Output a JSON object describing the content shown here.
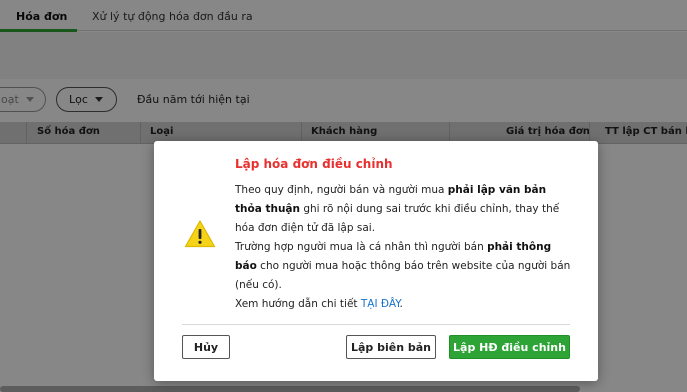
{
  "tabs": [
    {
      "label": "Hóa đơn",
      "active": true
    },
    {
      "label": "Xử lý tự động hóa đơn đầu ra",
      "active": false
    }
  ],
  "filters": {
    "truncated_chip": "oạt",
    "filter_chip": "Lọc",
    "period": "Đầu năm tới hiện tại"
  },
  "table": {
    "columns": [
      "Số hóa đơn",
      "Loại",
      "Khách hàng",
      "Giá trị hóa đơn",
      "TT lập CT bán hàng"
    ]
  },
  "dialog": {
    "title": "Lập hóa đơn điều chỉnh",
    "p1_a": "Theo quy định, người bán và người mua ",
    "p1_b": "phải lập văn bản thỏa thuận",
    "p1_c": " ghi rõ nội dung sai trước khi điều chỉnh, thay thế hóa đơn điện tử đã lập sai.",
    "p2_a": "Trường hợp người mua là cá nhân thì người bán ",
    "p2_b": "phải thông báo",
    "p2_c": " cho người mua hoặc thông báo trên website của người bán (nếu có).",
    "p3_a": "Xem hướng dẫn chi tiết ",
    "p3_link": "TẠI ĐÂY",
    "p3_c": ".",
    "buttons": {
      "cancel": "Hủy",
      "minutes": "Lập biên bản",
      "adjust": "Lập HĐ điều chỉnh"
    },
    "icon": "warning-icon"
  },
  "colors": {
    "accent_green": "#2ea336",
    "title_red": "#e8312f",
    "link_blue": "#1a73c8",
    "warning_yellow": "#f5d316"
  }
}
